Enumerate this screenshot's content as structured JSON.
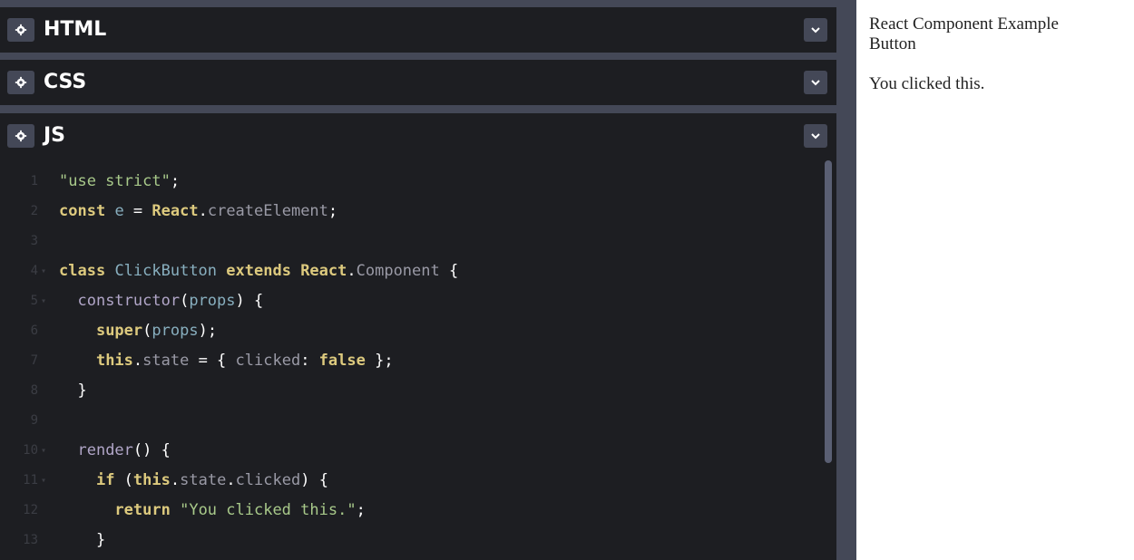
{
  "panels": [
    {
      "title": "HTML"
    },
    {
      "title": "CSS"
    },
    {
      "title": "JS"
    }
  ],
  "code_lines": [
    {
      "num": "1",
      "fold": false,
      "segments": [
        [
          "str",
          "\"use strict\""
        ],
        [
          "plain",
          ";"
        ]
      ]
    },
    {
      "num": "2",
      "fold": false,
      "segments": [
        [
          "kw",
          "const"
        ],
        [
          "plain",
          " "
        ],
        [
          "var",
          "e"
        ],
        [
          "plain",
          " = "
        ],
        [
          "kw",
          "React"
        ],
        [
          "plain",
          "."
        ],
        [
          "prop",
          "createElement"
        ],
        [
          "plain",
          ";"
        ]
      ]
    },
    {
      "num": "3",
      "fold": false,
      "segments": []
    },
    {
      "num": "4",
      "fold": true,
      "segments": [
        [
          "kw",
          "class"
        ],
        [
          "plain",
          " "
        ],
        [
          "cls",
          "ClickButton"
        ],
        [
          "plain",
          " "
        ],
        [
          "kw",
          "extends"
        ],
        [
          "plain",
          " "
        ],
        [
          "kw",
          "React"
        ],
        [
          "plain",
          "."
        ],
        [
          "prop",
          "Component"
        ],
        [
          "plain",
          " {"
        ]
      ]
    },
    {
      "num": "5",
      "fold": true,
      "segments": [
        [
          "plain",
          "  "
        ],
        [
          "fn",
          "constructor"
        ],
        [
          "plain",
          "("
        ],
        [
          "var",
          "props"
        ],
        [
          "plain",
          ") {"
        ]
      ]
    },
    {
      "num": "6",
      "fold": false,
      "segments": [
        [
          "plain",
          "    "
        ],
        [
          "kw",
          "super"
        ],
        [
          "plain",
          "("
        ],
        [
          "var",
          "props"
        ],
        [
          "plain",
          ");"
        ]
      ]
    },
    {
      "num": "7",
      "fold": false,
      "segments": [
        [
          "plain",
          "    "
        ],
        [
          "kw",
          "this"
        ],
        [
          "plain",
          "."
        ],
        [
          "prop",
          "state"
        ],
        [
          "plain",
          " = { "
        ],
        [
          "prop",
          "clicked"
        ],
        [
          "plain",
          ": "
        ],
        [
          "kw",
          "false"
        ],
        [
          "plain",
          " };"
        ]
      ]
    },
    {
      "num": "8",
      "fold": false,
      "segments": [
        [
          "plain",
          "  }"
        ]
      ]
    },
    {
      "num": "9",
      "fold": false,
      "segments": []
    },
    {
      "num": "10",
      "fold": true,
      "segments": [
        [
          "plain",
          "  "
        ],
        [
          "fn",
          "render"
        ],
        [
          "plain",
          "() {"
        ]
      ]
    },
    {
      "num": "11",
      "fold": true,
      "segments": [
        [
          "plain",
          "    "
        ],
        [
          "kw",
          "if"
        ],
        [
          "plain",
          " ("
        ],
        [
          "kw",
          "this"
        ],
        [
          "plain",
          "."
        ],
        [
          "prop",
          "state"
        ],
        [
          "plain",
          "."
        ],
        [
          "prop",
          "clicked"
        ],
        [
          "plain",
          ") {"
        ]
      ]
    },
    {
      "num": "12",
      "fold": false,
      "segments": [
        [
          "plain",
          "      "
        ],
        [
          "kw",
          "return"
        ],
        [
          "plain",
          " "
        ],
        [
          "str",
          "\"You clicked this.\""
        ],
        [
          "plain",
          ";"
        ]
      ]
    },
    {
      "num": "13",
      "fold": false,
      "segments": [
        [
          "plain",
          "    }"
        ]
      ]
    }
  ],
  "preview": {
    "heading": "React Component Example",
    "button_label": "Button",
    "message": "You clicked this."
  },
  "colors": {
    "editor_bg": "#1d1e22",
    "divider": "#444857",
    "keyword": "#ddca7e",
    "string": "#a8c98a",
    "variable": "#88afbf"
  },
  "icons": {
    "settings": "gear-icon",
    "collapse": "chevron-down-icon"
  }
}
